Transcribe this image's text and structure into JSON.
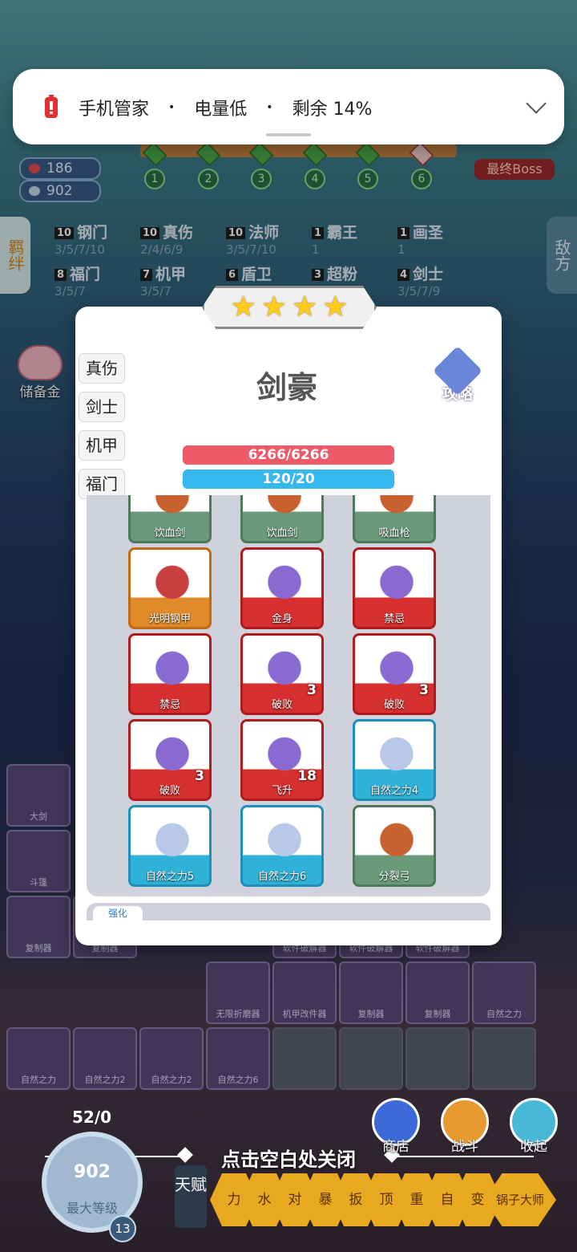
{
  "notification": {
    "app": "手机管家",
    "dot1": "•",
    "title": "电量低",
    "dot2": "•",
    "detail": "剩余 14%"
  },
  "hud": {
    "health": "186",
    "coins": "902",
    "stages": [
      "1",
      "2",
      "3",
      "4",
      "5",
      "6"
    ],
    "final_boss": "最终Boss",
    "left_tab": "羁绊",
    "right_tab": "敌方",
    "piggy_label": "储备金"
  },
  "traits": [
    {
      "num": "10",
      "name": "钢门",
      "levels": "3/5/7/10"
    },
    {
      "num": "10",
      "name": "真伤",
      "levels": "2/4/6/9"
    },
    {
      "num": "10",
      "name": "法师",
      "levels": "3/5/7/10"
    },
    {
      "num": "1",
      "name": "霸王",
      "levels": "1"
    },
    {
      "num": "1",
      "name": "画圣",
      "levels": "1"
    },
    {
      "num": "8",
      "name": "福门",
      "levels": "3/5/7"
    },
    {
      "num": "7",
      "name": "机甲",
      "levels": "3/5/7"
    },
    {
      "num": "6",
      "name": "盾卫",
      "levels": "3/5/7/10"
    },
    {
      "num": "3",
      "name": "超粉",
      "levels": ""
    },
    {
      "num": "4",
      "name": "剑士",
      "levels": "3/5/7/9"
    }
  ],
  "modal": {
    "stars": 4,
    "hero_name": "剑豪",
    "guide_label": "攻略",
    "hp": "6266/6266",
    "mp": "120/20",
    "side_tabs": [
      "真伤",
      "剑士",
      "机甲",
      "福门"
    ],
    "equipment": [
      {
        "label": "饮血剑",
        "rarity": "green",
        "count": ""
      },
      {
        "label": "饮血剑",
        "rarity": "green",
        "count": ""
      },
      {
        "label": "吸血枪",
        "rarity": "green",
        "count": ""
      },
      {
        "label": "光明钢甲",
        "rarity": "orange",
        "count": ""
      },
      {
        "label": "金身",
        "rarity": "red",
        "count": ""
      },
      {
        "label": "禁忌",
        "rarity": "red",
        "count": ""
      },
      {
        "label": "禁忌",
        "rarity": "red",
        "count": ""
      },
      {
        "label": "破败",
        "rarity": "red",
        "count": "3"
      },
      {
        "label": "破败",
        "rarity": "red",
        "count": "3"
      },
      {
        "label": "破败",
        "rarity": "red",
        "count": "3"
      },
      {
        "label": "飞升",
        "rarity": "red",
        "count": "18"
      },
      {
        "label": "自然之力4",
        "rarity": "cyan",
        "count": ""
      },
      {
        "label": "自然之力5",
        "rarity": "cyan",
        "count": ""
      },
      {
        "label": "自然之力6",
        "rarity": "cyan",
        "count": ""
      },
      {
        "label": "分裂弓",
        "rarity": "green",
        "count": ""
      }
    ],
    "sub_tab": "强化"
  },
  "inventory": [
    {
      "label": "大剑"
    },
    {
      "label": "斗篷"
    },
    {
      "label": "复制器"
    },
    {
      "label": "复制器"
    },
    {
      "label": "软件破解器"
    },
    {
      "label": "软件破解器"
    },
    {
      "label": "软件破解器"
    },
    {
      "label": "无限折磨器"
    },
    {
      "label": "机甲改件器"
    },
    {
      "label": "复制器"
    },
    {
      "label": "复制器"
    },
    {
      "label": "自然之力"
    },
    {
      "label": "自然之力"
    },
    {
      "label": "自然之力2"
    },
    {
      "label": "自然之力2"
    },
    {
      "label": "自然之力6"
    }
  ],
  "bottom": {
    "close_hint": "点击空白处关闭",
    "unit_count": "52/0",
    "coins": "902",
    "level_label": "最大等级",
    "level": "13",
    "shop": "商店",
    "battle": "战斗",
    "collapse": "收起",
    "talent": "天赋",
    "talent_items": [
      "力",
      "水",
      "对",
      "暴",
      "扳",
      "顶",
      "重",
      "自",
      "变",
      "锅子大师"
    ]
  },
  "colors": {
    "hp_bar": "#ee5a68",
    "mp_bar": "#34b8ee",
    "star": "#ffcc1a",
    "rarity_red": "#d73030",
    "rarity_cyan": "#2fb2d8",
    "rarity_orange": "#e08a2a",
    "rarity_green": "#6a9a7a"
  }
}
